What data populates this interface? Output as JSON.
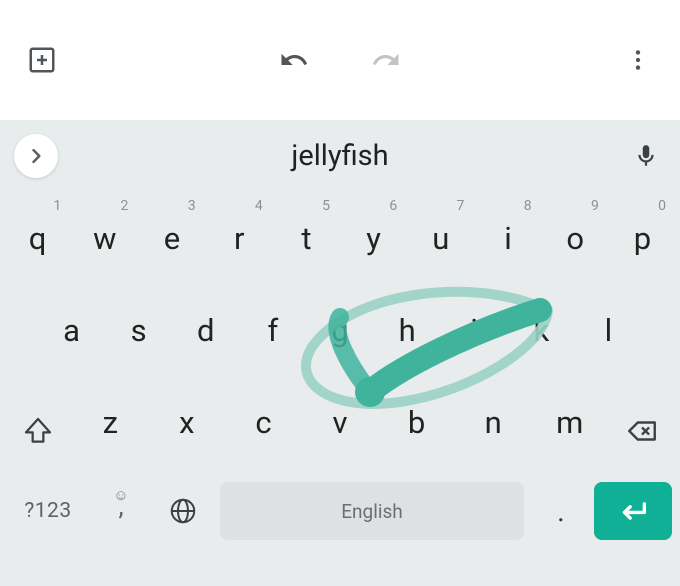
{
  "topbar": {},
  "suggestion": {
    "text": "jellyfish"
  },
  "rows": {
    "r1": {
      "hints": [
        "1",
        "2",
        "3",
        "4",
        "5",
        "6",
        "7",
        "8",
        "9",
        "0"
      ],
      "keys": [
        "q",
        "w",
        "e",
        "r",
        "t",
        "y",
        "u",
        "i",
        "o",
        "p"
      ]
    },
    "r2": {
      "keys": [
        "a",
        "s",
        "d",
        "f",
        "g",
        "h",
        "j",
        "k",
        "l"
      ]
    },
    "r3": {
      "keys": [
        "z",
        "x",
        "c",
        "v",
        "b",
        "n",
        "m"
      ]
    }
  },
  "bottom": {
    "symbols_label": "?123",
    "space_label": "English",
    "comma": ",",
    "period": "."
  },
  "colors": {
    "accent": "#0fb095",
    "swipe": "#3fb39c",
    "swipe_light": "#9ad1c5"
  }
}
